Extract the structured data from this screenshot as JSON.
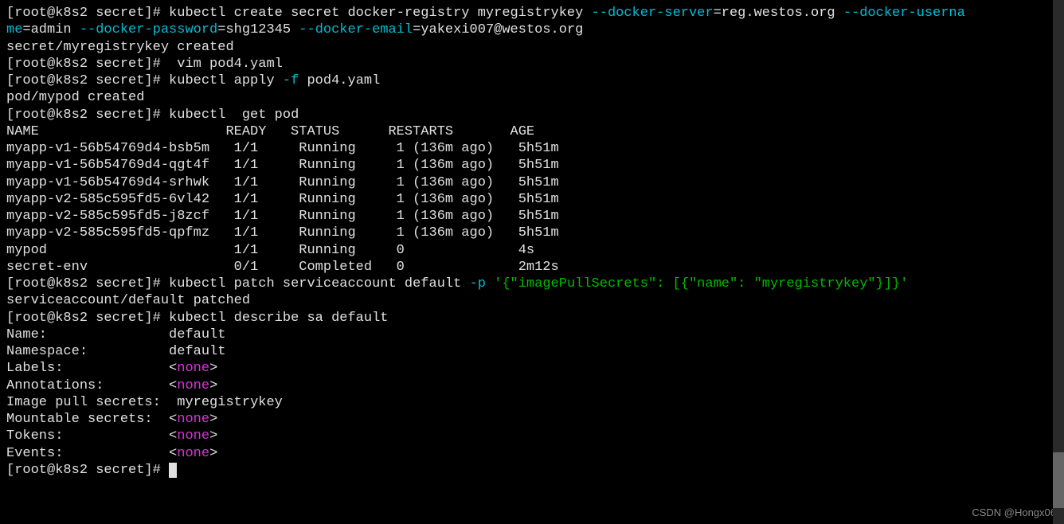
{
  "prompt": {
    "full": "[root@k8s2 secret]#"
  },
  "lines": {
    "l1_cmd_part1": " kubectl create secret docker-registry myregistrykey ",
    "l1_flag1": "--docker-server",
    "l1_val1": "=reg.westos.org ",
    "l1_flag2": "--docker-userna",
    "l1_flag2b": "me",
    "l1_val2": "=admin ",
    "l1_flag3": "--docker-password",
    "l1_val3": "=shg12345 ",
    "l1_flag4": "--docker-email",
    "l1_val4": "=yakexi007@westos.org",
    "l2": "secret/myregistrykey created",
    "l3_cmd": "  vim pod4.yaml",
    "l4_cmd": " kubectl apply ",
    "l4_flag": "-f",
    "l4_arg": " pod4.yaml",
    "l5": "pod/mypod created",
    "l6_cmd": " kubectl  get pod",
    "l7": "NAME                       READY   STATUS      RESTARTS       AGE",
    "l8": "myapp-v1-56b54769d4-bsb5m   1/1     Running     1 (136m ago)   5h51m",
    "l9": "myapp-v1-56b54769d4-qgt4f   1/1     Running     1 (136m ago)   5h51m",
    "l10": "myapp-v1-56b54769d4-srhwk   1/1     Running     1 (136m ago)   5h51m",
    "l11": "myapp-v2-585c595fd5-6vl42   1/1     Running     1 (136m ago)   5h51m",
    "l12": "myapp-v2-585c595fd5-j8zcf   1/1     Running     1 (136m ago)   5h51m",
    "l13": "myapp-v2-585c595fd5-qpfmz   1/1     Running     1 (136m ago)   5h51m",
    "l14": "mypod                       1/1     Running     0              4s",
    "l15": "secret-env                  0/1     Completed   0              2m12s",
    "l16_cmd": " kubectl patch serviceaccount default ",
    "l16_flag": "-p",
    "l16_space": " ",
    "l16_string": "'{\"imagePullSecrets\": [{\"name\": \"myregistrykey\"}]}'",
    "l17": "serviceaccount/default patched",
    "l18_cmd": " kubectl describe sa default",
    "l19_label": "Name:               ",
    "l19_val": "default",
    "l20_label": "Namespace:          ",
    "l20_val": "default",
    "l21_label": "Labels:             ",
    "l21_lt": "<",
    "l21_none": "none",
    "l21_gt": ">",
    "l22_label": "Annotations:        ",
    "l23_label": "Image pull secrets: ",
    "l23_val": " myregistrykey",
    "l24_label": "Mountable secrets:  ",
    "l25_label": "Tokens:             ",
    "l26_label": "Events:             ",
    "watermark": "CSDN @Hongx06"
  }
}
